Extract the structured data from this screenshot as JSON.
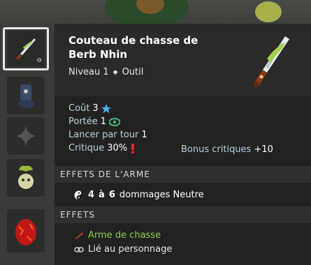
{
  "item": {
    "name": "Couteau de chasse de Berb Nhin",
    "level": "Niveau 1",
    "type": "Outil"
  },
  "stats": {
    "cost_label": "Coût",
    "cost_value": "3",
    "range_label": "Portée",
    "range_value": "1",
    "casts_label": "Lancer par tour",
    "casts_value": "1",
    "crit_label": "Critique",
    "crit_value": "30%",
    "crit_bonus_label": "Bonus critiques",
    "crit_bonus_value": "+10"
  },
  "sections": {
    "weapon_effects_title": "EFFETS DE L'ARME",
    "effects_title": "EFFETS"
  },
  "weapon_effects": [
    {
      "min": "4",
      "sep": "à",
      "max": "6",
      "text": "dommages Neutre",
      "icon": "neutral-element-icon"
    }
  ],
  "effects": [
    {
      "text": "Arme de chasse",
      "icon": "hunting-icon",
      "color": "#8dcf4a"
    },
    {
      "text": "Lié au personnage",
      "icon": "link-icon",
      "color": "#e8e8e8"
    }
  ],
  "inventory": [
    {
      "name": "hunting-knife",
      "selected": true
    },
    {
      "name": "boot"
    },
    {
      "name": "empty-emblem"
    },
    {
      "name": "plant-pet"
    },
    {
      "name": "red-egg"
    }
  ],
  "colors": {
    "label": "#b9d3de",
    "value": "#ffffff",
    "green": "#8dcf4a",
    "star": "#4fb3e8",
    "eye": "#3fc07a",
    "exclaim": "#e02a2a"
  }
}
